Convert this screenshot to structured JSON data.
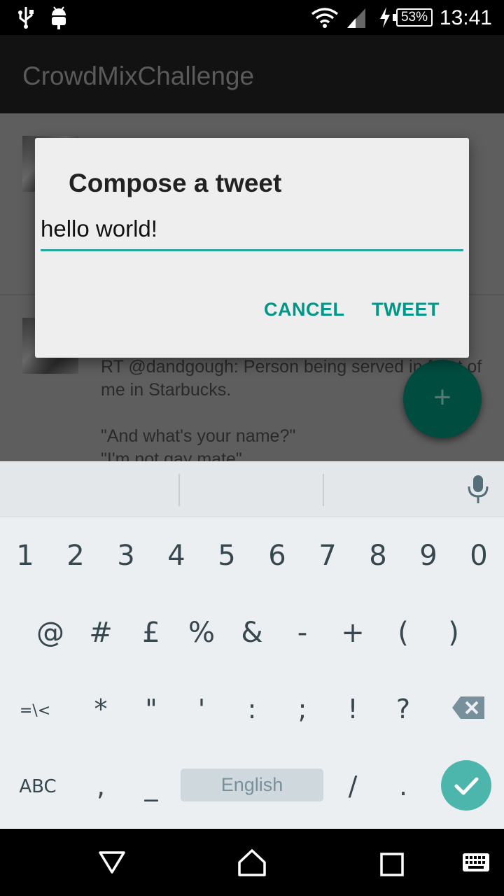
{
  "status_bar": {
    "time": "13:41",
    "battery": "53%",
    "icons": [
      "usb-icon",
      "android-debug-icon",
      "wifi-icon",
      "signal-icon",
      "charging-icon",
      "battery-icon"
    ]
  },
  "app_bar": {
    "title": "CrowdMixChallenge"
  },
  "feed": {
    "tweet_text": "RT @dandgough: Person being served in front of me in Starbucks.\n\n\"And what's your name?\"\n\"I'm not gay mate\""
  },
  "dialog": {
    "title": "Compose a tweet",
    "input_value": "hello world!",
    "cancel_label": "CANCEL",
    "tweet_label": "TWEET"
  },
  "fab": {
    "symbol": "+"
  },
  "keyboard": {
    "row1": [
      "1",
      "2",
      "3",
      "4",
      "5",
      "6",
      "7",
      "8",
      "9",
      "0"
    ],
    "row2": [
      "@",
      "#",
      "£",
      "%",
      "&",
      "-",
      "+",
      "(",
      ")"
    ],
    "row3": [
      "=\\<",
      "*",
      "\"",
      "'",
      ":",
      ";",
      "!",
      "?"
    ],
    "row4": [
      "ABC",
      ",",
      "_",
      "English",
      "/",
      "."
    ],
    "accent": "#4db6ac"
  },
  "colors": {
    "accent": "#009688",
    "fab": "#004d40",
    "input_underline": "#26a69a"
  }
}
